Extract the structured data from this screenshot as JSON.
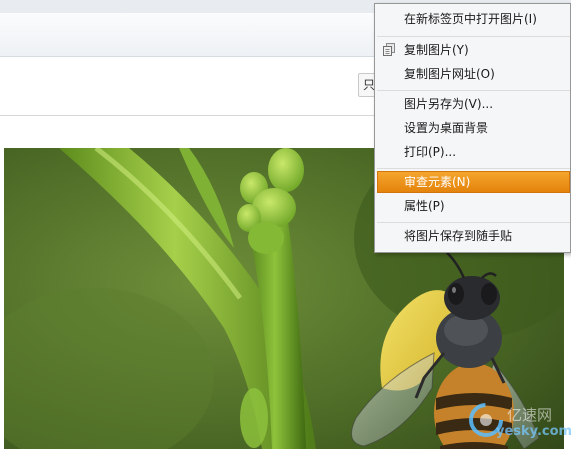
{
  "toolbar": {
    "partial_button_label": "只"
  },
  "context_menu": {
    "items": [
      {
        "label": "在新标签页中打开图片(I)"
      },
      {
        "label": "复制图片(Y)",
        "icon": "copy-icon"
      },
      {
        "label": "复制图片网址(O)"
      },
      {
        "label": "图片另存为(V)..."
      },
      {
        "label": "设置为桌面背景"
      },
      {
        "label": "打印(P)..."
      },
      {
        "label": "审查元素(N)",
        "selected": true
      },
      {
        "label": "属性(P)"
      },
      {
        "label": "将图片保存到随手贴"
      }
    ],
    "highlight_color": "#e99014"
  },
  "watermark": {
    "site_name": "亿速网",
    "site_url": "yesky.com"
  }
}
